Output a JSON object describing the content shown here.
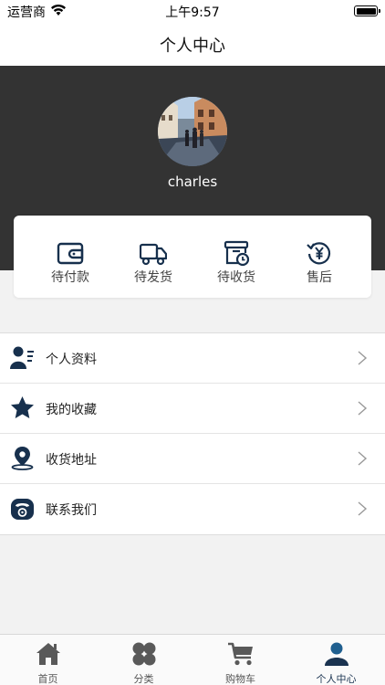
{
  "status_bar": {
    "carrier": "运营商",
    "time": "上午9:57"
  },
  "nav": {
    "title": "个人中心"
  },
  "profile": {
    "username": "charles"
  },
  "orders": [
    {
      "label": "待付款",
      "icon": "wallet-icon"
    },
    {
      "label": "待发货",
      "icon": "truck-icon"
    },
    {
      "label": "待收货",
      "icon": "delivery-box-icon"
    },
    {
      "label": "售后",
      "icon": "refund-yen-icon"
    }
  ],
  "menu": [
    {
      "label": "个人资料",
      "icon": "user-profile-icon"
    },
    {
      "label": "我的收藏",
      "icon": "star-icon"
    },
    {
      "label": "收货地址",
      "icon": "location-pin-icon"
    },
    {
      "label": "联系我们",
      "icon": "telephone-icon"
    }
  ],
  "tabs": [
    {
      "label": "首页",
      "icon": "home-icon"
    },
    {
      "label": "分类",
      "icon": "category-icon"
    },
    {
      "label": "购物车",
      "icon": "cart-icon"
    },
    {
      "label": "个人中心",
      "icon": "person-icon",
      "active": true
    }
  ],
  "colors": {
    "accent": "#1a3350",
    "header_bg": "#333333",
    "icon_dark": "#17304d"
  }
}
